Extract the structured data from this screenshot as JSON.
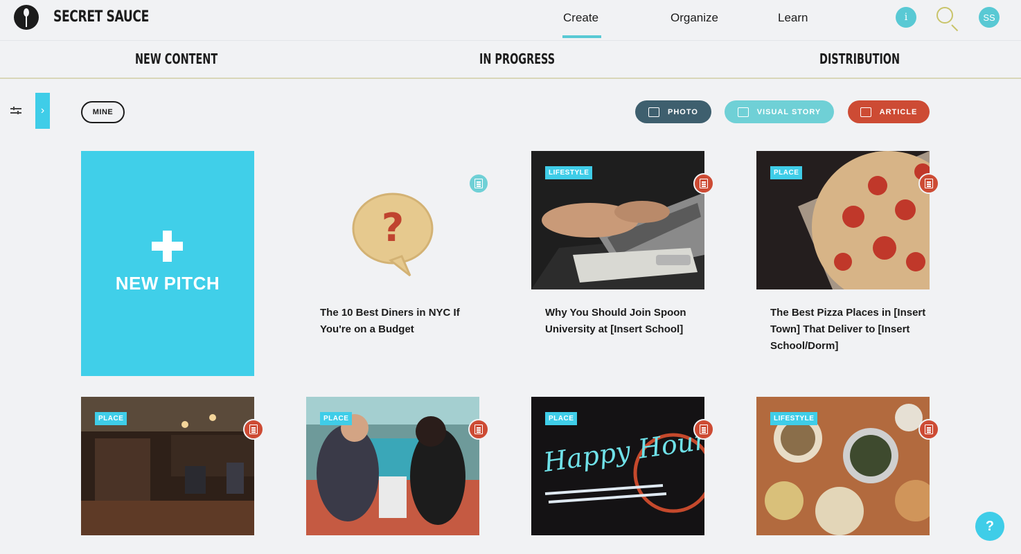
{
  "brand": {
    "name": "SECRET SAUCE"
  },
  "nav": {
    "items": [
      "Create",
      "Organize",
      "Learn"
    ],
    "active": "Create"
  },
  "header_actions": {
    "info": "i",
    "user_initials": "SS"
  },
  "sections": [
    "NEW CONTENT",
    "IN PROGRESS",
    "DISTRIBUTION"
  ],
  "filters": {
    "mine": "MINE",
    "types": [
      "PHOTO",
      "VISUAL STORY",
      "ARTICLE"
    ]
  },
  "new_pitch": {
    "plus": "+",
    "label": "NEW PITCH"
  },
  "cards": [
    {
      "title": "The 10 Best Diners in NYC If You're on a Budget",
      "category": "",
      "type": "visual-story",
      "type_icon": "visual-story-icon"
    },
    {
      "title": "Why You Should Join Spoon University at [Insert School]",
      "category": "LIFESTYLE",
      "type": "article",
      "type_icon": "article-icon"
    },
    {
      "title": "The Best Pizza Places in [Insert Town] That Deliver to [Insert School/Dorm]",
      "category": "PLACE",
      "type": "article",
      "type_icon": "article-icon"
    },
    {
      "title": "",
      "category": "PLACE",
      "type": "article",
      "type_icon": "article-icon"
    },
    {
      "title": "",
      "category": "PLACE",
      "type": "article",
      "type_icon": "article-icon"
    },
    {
      "title": "",
      "category": "PLACE",
      "type": "article",
      "type_icon": "article-icon",
      "image_text": "Happy Hour"
    },
    {
      "title": "",
      "category": "LIFESTYLE",
      "type": "article",
      "type_icon": "article-icon"
    }
  ],
  "help": {
    "label": "?"
  },
  "colors": {
    "accent": "#3fcde8",
    "teal": "#6fd0d6",
    "photo": "#3e5f6e",
    "article": "#cd4b34",
    "background": "#f1f2f4"
  }
}
